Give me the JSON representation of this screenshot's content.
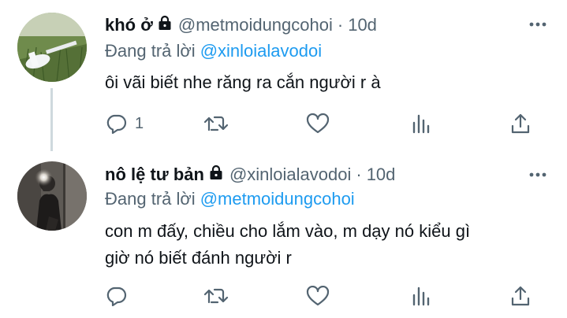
{
  "tweets": [
    {
      "display_name": "khó ở",
      "handle": "@metmoidungcohoi",
      "separator": "·",
      "time": "10d",
      "reply_prefix": "Đang trả lời",
      "reply_to": "@xinloialavodoi",
      "text_lines": [
        "ôi vãi biết nhe răng ra cắn người r à"
      ],
      "actions": {
        "reply_count": "1"
      }
    },
    {
      "display_name": "nô lệ tư bản",
      "handle": "@xinloialavodoi",
      "separator": "·",
      "time": "10d",
      "reply_prefix": "Đang trả lời",
      "reply_to": "@metmoidungcohoi",
      "text_lines": [
        "con m đấy, chiều cho lắm vào, m dạy nó kiểu gì",
        "giờ nó biết đánh người r"
      ]
    }
  ],
  "icons": {
    "lock": "lock-icon",
    "more": "more-icon",
    "reply": "reply-icon",
    "retweet": "retweet-icon",
    "like": "heart-icon",
    "views": "bar-chart-icon",
    "share": "share-icon"
  },
  "colors": {
    "text_primary": "#0f1419",
    "text_secondary": "#536471",
    "mention": "#1d9bf0",
    "thread_line": "#cfd9de"
  }
}
